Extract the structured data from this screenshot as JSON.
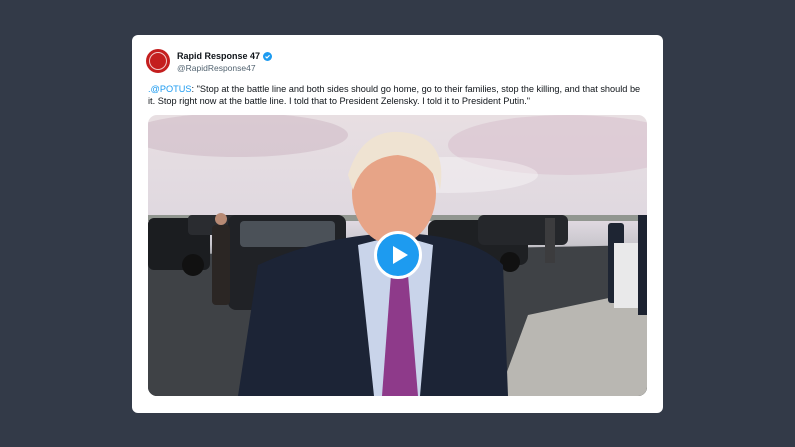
{
  "tweet": {
    "author": {
      "display_name": "Rapid Response 47",
      "handle": "@RapidResponse47",
      "verified": true,
      "avatar_icon": "campaign-seal-icon"
    },
    "mention": ".@POTUS",
    "text": ": \"Stop at the battle line and both sides should go home, go to their families, stop the killing, and that should be it. Stop right now at the battle line. I told that to President Zelensky. I told it to President Putin.\""
  },
  "media": {
    "type": "video",
    "play_icon": "play-icon"
  },
  "colors": {
    "page_bg": "#333a48",
    "card_bg": "#ffffff",
    "link": "#1d9bf0",
    "play_button": "#1d9bf0",
    "avatar_bg": "#c41e1e"
  }
}
